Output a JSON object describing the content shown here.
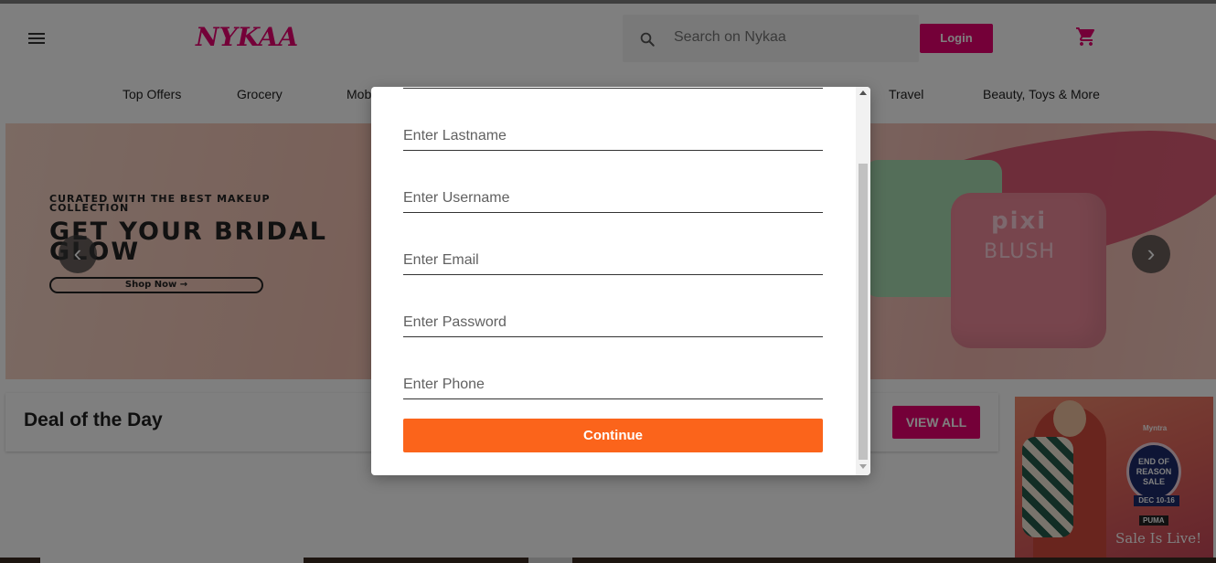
{
  "header": {
    "logo_text": "NYKAA",
    "search_placeholder": "Search on Nykaa",
    "login_label": "Login",
    "icons": {
      "menu": "hamburger-menu-icon",
      "search": "search-icon",
      "cart": "shopping-cart-icon"
    },
    "colors": {
      "brand": "#e80071"
    }
  },
  "nav": {
    "items": [
      {
        "label": "Top Offers"
      },
      {
        "label": "Grocery"
      },
      {
        "label": "Mob"
      },
      {
        "label": "Travel"
      },
      {
        "label": "Beauty, Toys & More"
      }
    ]
  },
  "banner": {
    "tagline": "CURATED WITH THE BEST MAKEUP COLLECTION",
    "headline": "GET YOUR BRIDAL GLOW",
    "cta": "Shop Now →",
    "product_brand": "pixi",
    "product_name": "BLUSH",
    "prev_icon": "chevron-left-icon",
    "next_icon": "chevron-right-icon"
  },
  "deal": {
    "title": "Deal of the Day",
    "view_all_label": "VIEW ALL"
  },
  "ad": {
    "brand": "Myntra",
    "seal_text": "END OF REASON SALE",
    "dates": "DEC 10-16",
    "partner": "PUMA",
    "tagline": "Sale Is Live!"
  },
  "modal": {
    "fields": {
      "lastname": {
        "placeholder": "Enter Lastname"
      },
      "username": {
        "placeholder": "Enter Username"
      },
      "email": {
        "placeholder": "Enter Email"
      },
      "password": {
        "placeholder": "Enter Password"
      },
      "phone": {
        "placeholder": "Enter Phone"
      }
    },
    "continue_label": "Continue",
    "colors": {
      "continue": "#fb641b"
    }
  }
}
